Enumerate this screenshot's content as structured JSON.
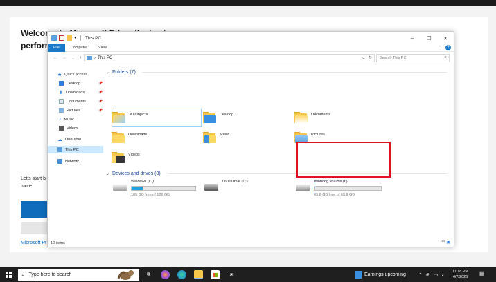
{
  "edge": {
    "heading_line1": "Welcome to Microsoft Edge, the best",
    "heading_line2": "perform",
    "paragraph": "Let's start b more.",
    "link": "Microsoft Pr"
  },
  "window": {
    "title": "This PC",
    "controls": {
      "minimize": "–",
      "maximize": "☐",
      "close": "✕"
    },
    "ribbon_tabs": [
      "File",
      "Computer",
      "View"
    ],
    "ribbon_expand": "⌄",
    "help": "?",
    "address": {
      "location": "This PC",
      "separator": "›"
    },
    "search_placeholder": "Search This PC",
    "status": "10 items"
  },
  "sidebar": {
    "quick_access": "Quick access",
    "items": [
      {
        "label": "Desktop",
        "icon": "desktop-icon",
        "pinned": true
      },
      {
        "label": "Downloads",
        "icon": "download-icon",
        "pinned": true
      },
      {
        "label": "Documents",
        "icon": "documents-icon",
        "pinned": true
      },
      {
        "label": "Pictures",
        "icon": "pictures-icon",
        "pinned": true
      },
      {
        "label": "Music",
        "icon": "music-icon",
        "pinned": false
      },
      {
        "label": "Videos",
        "icon": "videos-icon",
        "pinned": false
      }
    ],
    "onedrive": "OneDrive",
    "thispc": "This PC",
    "network": "Network"
  },
  "content": {
    "folders_header": "Folders (7)",
    "folders": [
      "3D Objects",
      "Desktop",
      "Documents",
      "Downloads",
      "Music",
      "Pictures",
      "Videos"
    ],
    "drives_header": "Devices and drives (3)",
    "drives": [
      {
        "name": "Windows (C:)",
        "free": "105 GB free of 126 GB",
        "used_fraction": 0.17
      },
      {
        "name": "DVD Drive (D:)",
        "free": "",
        "used_fraction": null
      },
      {
        "name": "Iniobong volume (I:)",
        "free": "63.8 GB free of 63.9 GB",
        "used_fraction": 0.002
      }
    ]
  },
  "taskbar": {
    "search_placeholder": "Type here to search",
    "news": "Earnings upcoming",
    "time": "11:18 PM",
    "date": "4/7/2025"
  },
  "colors": {
    "accent": "#1979ca",
    "highlight": "#e0141e",
    "selected": "#cce8ff"
  }
}
